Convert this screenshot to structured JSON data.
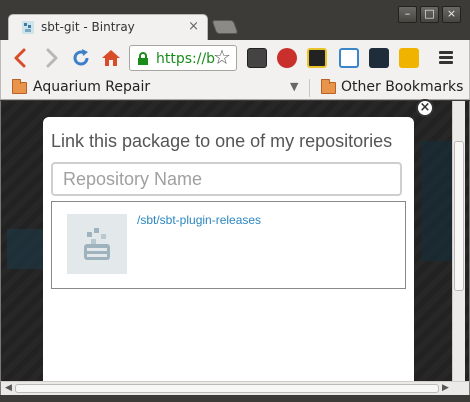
{
  "browser": {
    "tab_title": "sbt-git - Bintray",
    "tab_close": "×",
    "url": "https://b",
    "window_buttons": {
      "minimize": "–",
      "maximize": "□",
      "close": "×"
    }
  },
  "bookmarks": {
    "left_folder": "Aquarium Repair",
    "right_folder": "Other Bookmarks"
  },
  "modal": {
    "title": "Link this package to one of my repositories",
    "input_placeholder": "Repository Name",
    "close_symbol": "×",
    "results": [
      {
        "label": "/sbt/sbt-plugin-releases"
      }
    ]
  },
  "toolbar": {
    "back_icon": "back-icon",
    "forward_icon": "forward-icon",
    "reload_icon": "reload-icon",
    "home_icon": "home-icon"
  },
  "colors": {
    "link": "#2a86c0",
    "url_secure": "#1a8c1a",
    "back_arrow": "#d94c2a"
  }
}
